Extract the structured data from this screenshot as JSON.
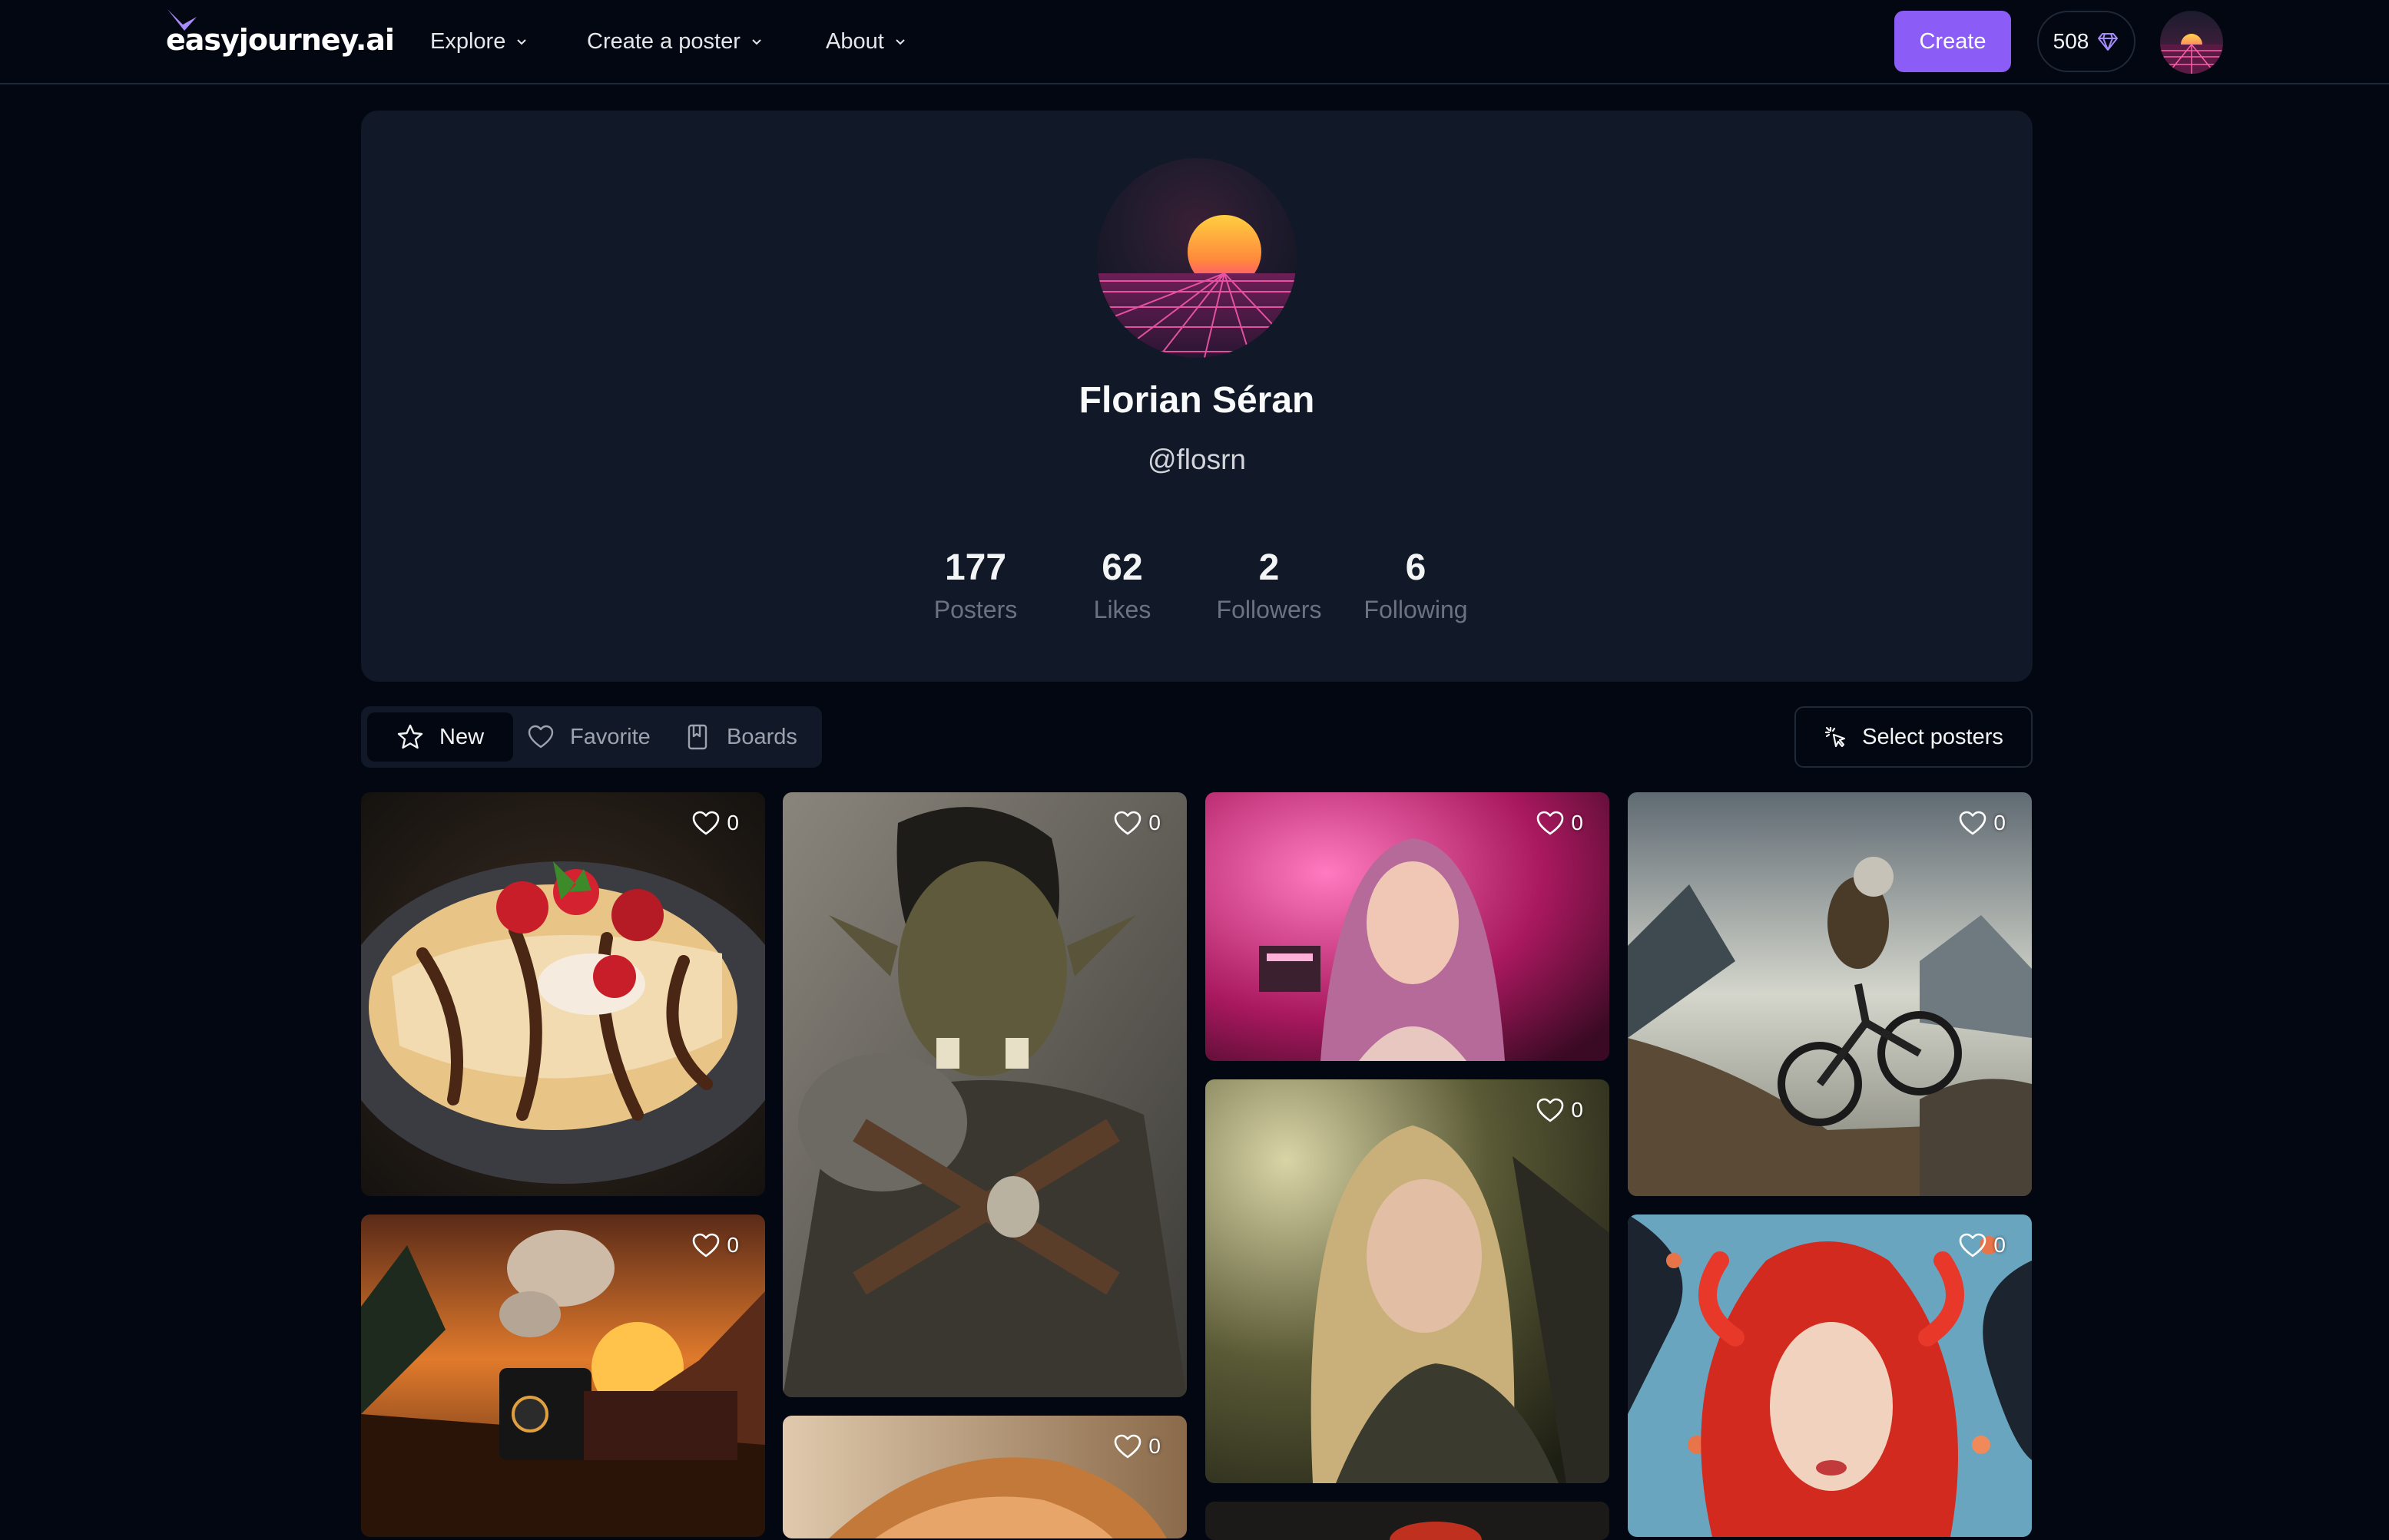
{
  "brand": {
    "name": "easyjourney.ai",
    "accent": "#8b5cf6"
  },
  "nav": {
    "menus": [
      "Explore",
      "Create a poster",
      "About"
    ],
    "create_label": "Create",
    "credits": "508"
  },
  "profile": {
    "name": "Florian Séran",
    "handle": "@flosrn",
    "stats": [
      {
        "value": "177",
        "label": "Posters"
      },
      {
        "value": "62",
        "label": "Likes"
      },
      {
        "value": "2",
        "label": "Followers"
      },
      {
        "value": "6",
        "label": "Following"
      }
    ]
  },
  "tabs": {
    "items": [
      {
        "label": "New",
        "icon": "star-icon",
        "active": true
      },
      {
        "label": "Favorite",
        "icon": "heart-icon",
        "active": false
      },
      {
        "label": "Boards",
        "icon": "bookmark-icon",
        "active": false
      }
    ],
    "select_label": "Select posters"
  },
  "posters": [
    {
      "subject": "crepes-with-strawberries-and-chocolate",
      "likes": "0"
    },
    {
      "subject": "orc-warrior",
      "likes": "0"
    },
    {
      "subject": "woman-with-pink-hair-neon",
      "likes": "0"
    },
    {
      "subject": "mountain-biker",
      "likes": "0"
    },
    {
      "subject": "steam-train-at-sunset",
      "likes": "0"
    },
    {
      "subject": "elf-woman-in-forest",
      "likes": "0"
    },
    {
      "subject": "red-haired-woman-with-fish",
      "likes": "0"
    },
    {
      "subject": "blonde-woman-closeup",
      "likes": "0"
    },
    {
      "subject": "partial-poster",
      "likes": ""
    }
  ]
}
